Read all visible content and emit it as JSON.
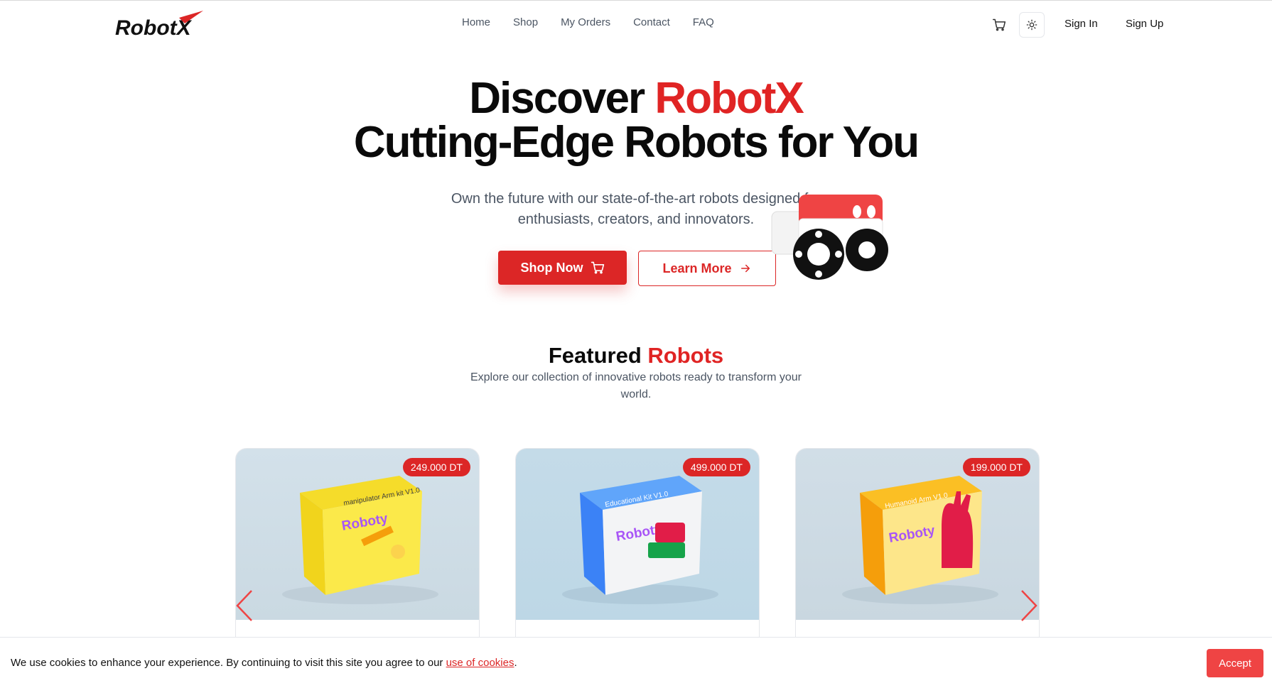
{
  "header": {
    "logo_text": "RobotX",
    "nav": [
      "Home",
      "Shop",
      "My Orders",
      "Contact",
      "FAQ"
    ],
    "cart_icon": "cart-icon",
    "theme_icon": "sun-icon",
    "sign_in": "Sign In",
    "sign_up": "Sign Up"
  },
  "hero": {
    "title_prefix": "Discover ",
    "title_accent": "RobotX",
    "title_line2": "Cutting-Edge Robots for You",
    "subtitle": "Own the future with our state-of-the-art robots designed for enthusiasts, creators, and innovators.",
    "primary_button": "Shop Now",
    "secondary_button": "Learn More"
  },
  "featured": {
    "title_prefix": "Featured ",
    "title_accent": "Robots",
    "subtitle": "Explore our collection of innovative robots ready to transform your world.",
    "products": [
      {
        "price": "249.000 DT",
        "box_label": "manipulator Arm kit V1.0",
        "brand": "Roboty"
      },
      {
        "price": "499.000 DT",
        "box_label": "Educational Kit V1.0",
        "brand": "Roboty"
      },
      {
        "price": "199.000 DT",
        "box_label": "Humanoid Arm V1.0",
        "brand": "Roboty"
      }
    ]
  },
  "cookie": {
    "text": "We use cookies to enhance your experience. By continuing to visit this site you agree to our ",
    "link": "use of cookies",
    "suffix": ".",
    "accept": "Accept"
  },
  "colors": {
    "accent": "#dc2626",
    "text": "#0a0a0a",
    "muted": "#4b5563"
  }
}
